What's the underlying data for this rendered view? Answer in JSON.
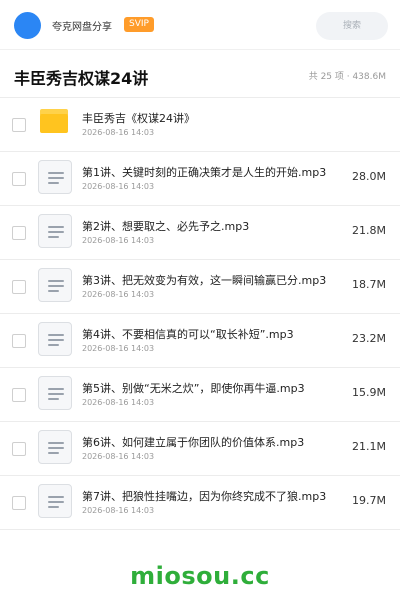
{
  "header": {
    "app_name": "夸克网盘分享",
    "badge": "SVIP",
    "search_label": "搜索"
  },
  "folder": {
    "title": "丰臣秀吉权谋24讲",
    "meta": "共 25 项 · 438.6M"
  },
  "items": [
    {
      "type": "folder",
      "icon": "folder-icon",
      "name": "丰臣秀吉《权谋24讲》",
      "date": "2026-08-16 14:03",
      "size": ""
    },
    {
      "type": "file",
      "icon": "document-icon",
      "name": "第1讲、关键时刻的正确决策才是人生的开始.mp3",
      "date": "2026-08-16 14:03",
      "size": "28.0M"
    },
    {
      "type": "file",
      "icon": "document-icon",
      "name": "第2讲、想要取之、必先予之.mp3",
      "date": "2026-08-16 14:03",
      "size": "21.8M"
    },
    {
      "type": "file",
      "icon": "document-icon",
      "name": "第3讲、把无效变为有效，这一瞬间输赢已分.mp3",
      "date": "2026-08-16 14:03",
      "size": "18.7M"
    },
    {
      "type": "file",
      "icon": "document-icon",
      "name": "第4讲、不要相信真的可以“取长补短”.mp3",
      "date": "2026-08-16 14:03",
      "size": "23.2M"
    },
    {
      "type": "file",
      "icon": "document-icon",
      "name": "第5讲、别做“无米之炊”，即使你再牛逼.mp3",
      "date": "2026-08-16 14:03",
      "size": "15.9M"
    },
    {
      "type": "file",
      "icon": "document-icon",
      "name": "第6讲、如何建立属于你团队的价值体系.mp3",
      "date": "2026-08-16 14:03",
      "size": "21.1M"
    },
    {
      "type": "file",
      "icon": "document-icon",
      "name": "第7讲、把狼性挂嘴边，因为你终究成不了狼.mp3",
      "date": "2026-08-16 14:03",
      "size": "19.7M"
    }
  ],
  "watermark": "miosou.cc",
  "colors": {
    "accent": "#2b86f4",
    "svip": "#ff9c2a",
    "folder": "#ffc41f",
    "watermark": "#2fae3a"
  }
}
